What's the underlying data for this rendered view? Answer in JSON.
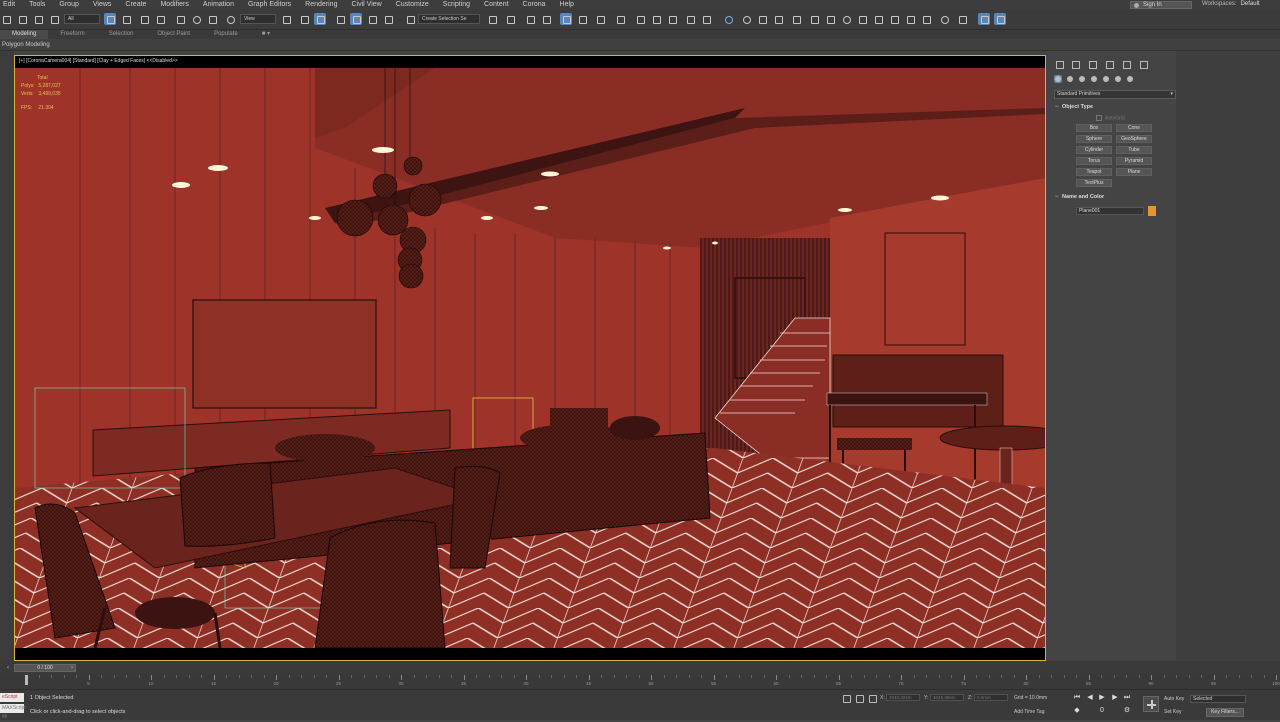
{
  "menu": [
    "Edit",
    "Tools",
    "Group",
    "Views",
    "Create",
    "Modifiers",
    "Animation",
    "Graph Editors",
    "Rendering",
    "Civil View",
    "Customize",
    "Scripting",
    "Content",
    "Corona",
    "Help"
  ],
  "signin": "Sign In",
  "workspaces": {
    "label": "Workspaces:",
    "value": "Default"
  },
  "toolbar": {
    "selection_filter": "All",
    "view_dropdown": "View",
    "selection_set": "Create Selection Se"
  },
  "ribbon_tabs": [
    "Modeling",
    "Freeform",
    "Selection",
    "Object Paint",
    "Populate"
  ],
  "ribbon_subtitle": "Polygon Modeling",
  "viewport": {
    "label": "[+] [CoronaCamera004] [Standard] [Clay + Edged Faces] <<Disabled>>",
    "stats": {
      "total_label": "Total",
      "polys_label": "Polys:",
      "polys": "5,287,027",
      "verts_label": "Verts:",
      "verts": "3,499,035",
      "fps_label": "FPS:",
      "fps": "21.304"
    },
    "colors": {
      "wall": "#a0372c",
      "wall_dark": "#7a2a22",
      "floor": "#8f3026",
      "wire": "#f0e0dc",
      "selection": "#d7b13a"
    }
  },
  "command_panel": {
    "category": "Standard Primitives",
    "object_type_title": "Object Type",
    "autogrid": "AutoGrid",
    "objects": [
      "Box",
      "Cone",
      "Sphere",
      "GeoSphere",
      "Cylinder",
      "Tube",
      "Torus",
      "Pyramid",
      "Teapot",
      "Plane",
      "TextPlus"
    ],
    "name_color_title": "Name and Color",
    "object_name": "Plane001",
    "object_color": "#e6952f"
  },
  "timeline": {
    "slider": "0 / 100",
    "frames": [
      "0",
      "5",
      "10",
      "15",
      "20",
      "25",
      "30",
      "35",
      "40",
      "45",
      "50",
      "55",
      "60",
      "65",
      "70",
      "75",
      "80",
      "85",
      "90",
      "95",
      "100"
    ]
  },
  "status": {
    "maxscript": "eScript",
    "maxscript2": "MAXScript Mi",
    "selected": "1 Object Selected",
    "prompt": "Click or click-and-drag to select objects",
    "x_label": "X:",
    "x_value": "3040.324m",
    "y_label": "Y:",
    "y_value": "4045.366m",
    "z_label": "Z:",
    "z_value": "0.0mm",
    "grid": "Grid = 10.0mm",
    "add_time_tag": "Add Time Tag",
    "auto_key": "Auto Key",
    "set_key": "Set Key",
    "key_mode": "Selected",
    "key_filters": "Key Filters..."
  }
}
